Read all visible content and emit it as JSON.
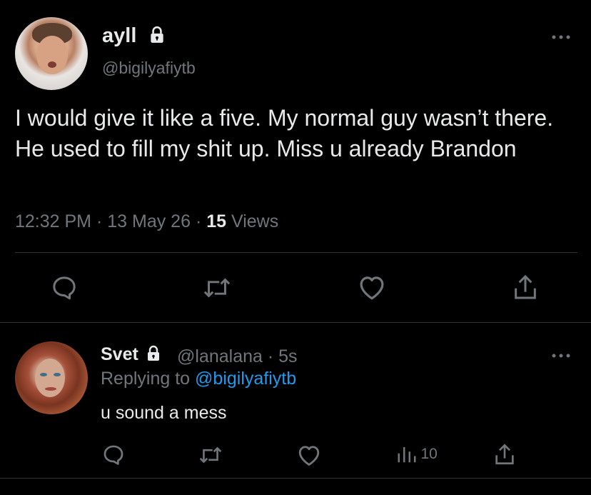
{
  "tweet": {
    "author_name": "ayll",
    "author_handle": "@bigilyafiytb",
    "more_icon": "more-dots-icon",
    "text": "I would give it like a five. My normal guy wasn’t there. He used to fill my shit up. Miss u already Brandon",
    "time": "12:32 PM",
    "separator1": "·",
    "date": "13 May 26",
    "separator2": "·",
    "views_count": "15",
    "views_label": "Views",
    "actions": [
      "reply-icon",
      "retweet-icon",
      "like-icon",
      "share-icon"
    ]
  },
  "reply": {
    "author_name": "Svet",
    "author_handle": "@lanalana",
    "separator": "·",
    "age": "5s",
    "replying_label": "Replying to",
    "replying_handle": "@bigilyafiytb",
    "text": "u sound a mess",
    "views_count": "10",
    "actions": [
      "reply-icon",
      "retweet-icon",
      "like-icon",
      "views-icon",
      "share-icon"
    ]
  },
  "colors": {
    "background": "#000000",
    "text_primary": "#e7e9ea",
    "text_secondary": "#71767b",
    "accent": "#1d9bf0",
    "divider": "#2f3336"
  }
}
